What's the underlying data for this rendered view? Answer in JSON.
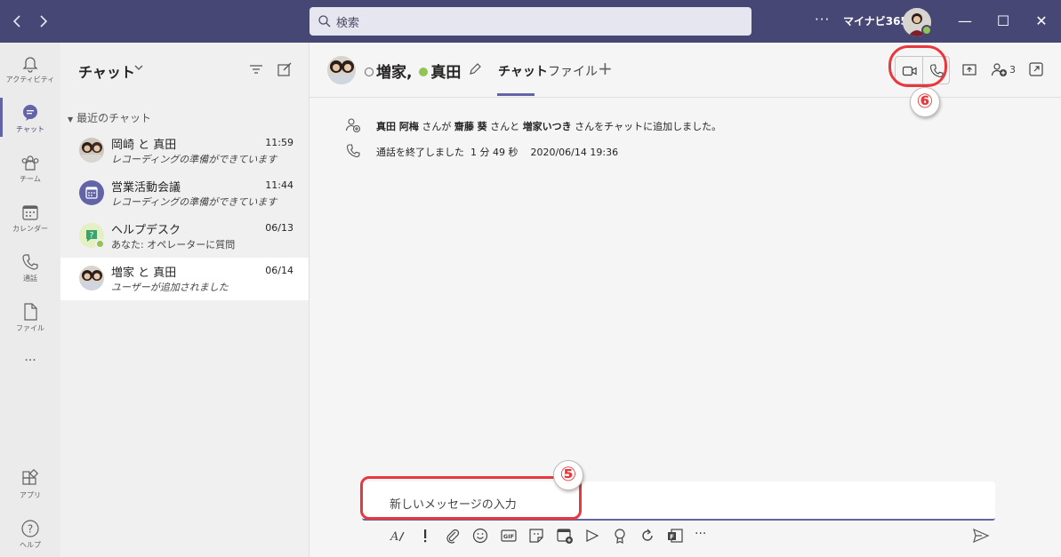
{
  "search": {
    "placeholder": "検索"
  },
  "topbar": {
    "more": "···",
    "org": "マイナビ365",
    "minimize": "—",
    "maximize": "☐",
    "close": "✕"
  },
  "rail": {
    "items": [
      {
        "label": "アクティビティ",
        "icon": "bell-icon"
      },
      {
        "label": "チャット",
        "icon": "chat-icon"
      },
      {
        "label": "チーム",
        "icon": "teams-icon"
      },
      {
        "label": "カレンダー",
        "icon": "calendar-icon"
      },
      {
        "label": "通話",
        "icon": "phone-icon"
      },
      {
        "label": "ファイル",
        "icon": "file-icon"
      },
      {
        "label": "アプリ",
        "icon": "apps-icon"
      },
      {
        "label": "ヘルプ",
        "icon": "help-icon"
      }
    ],
    "more": "···"
  },
  "chatlist": {
    "title": "チャット",
    "section": "最近のチャット",
    "items": [
      {
        "name": "岡崎 と 真田",
        "time": "11:59",
        "sub": "レコーディングの準備ができています"
      },
      {
        "name": "営業活動会議",
        "time": "11:44",
        "sub": "レコーディングの準備ができています"
      },
      {
        "name": "ヘルプデスク",
        "time": "06/13",
        "sub": "あなた: オペレーターに質問"
      },
      {
        "name": "増家 と 真田",
        "time": "06/14",
        "sub": "ユーザーが追加されました"
      }
    ]
  },
  "header": {
    "title_a": "増家,",
    "title_b": "真田",
    "tabs": [
      "チャット",
      "ファイル"
    ],
    "add_tab": "+",
    "participants": "3"
  },
  "messages": [
    {
      "text_parts": [
        "真田 阿梅",
        " さんが ",
        "齋藤 葵",
        " さんと ",
        "増家いつき",
        " さんをチャットに追加しました。"
      ],
      "icon": "add-person-icon"
    },
    {
      "text": "通話を終了しました  1 分 49 秒    2020/06/14 19:36",
      "icon": "phone-icon"
    }
  ],
  "compose": {
    "placeholder": "新しいメッセージの入力"
  },
  "toolbar": {
    "more": "···"
  },
  "annotations": {
    "five": "⑤",
    "six": "⑥"
  },
  "colors": {
    "brand": "#464775",
    "accent": "#6264a7",
    "annotation": "#e8383d",
    "online": "#92c353"
  }
}
